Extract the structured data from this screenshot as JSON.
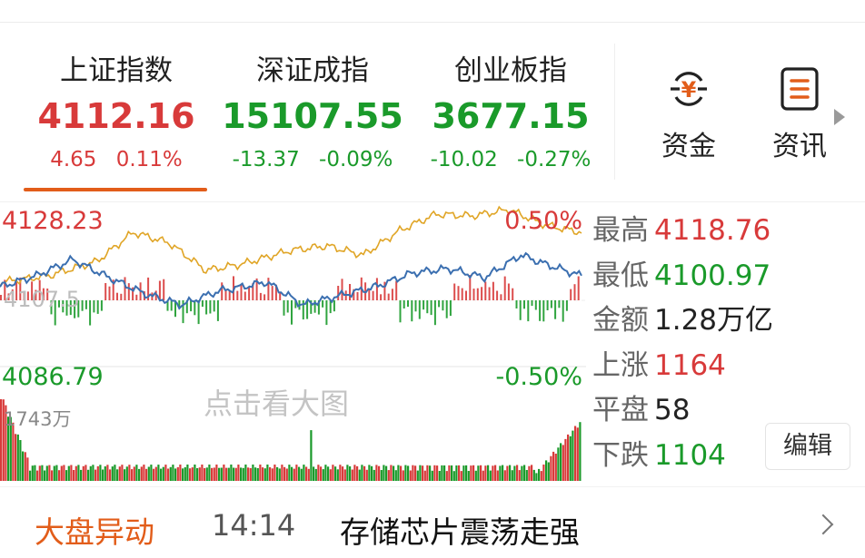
{
  "indices": [
    {
      "name": "上证指数",
      "value": "4112.16",
      "change": "4.65",
      "pct": "0.11%",
      "trend": "up",
      "active": true
    },
    {
      "name": "深证成指",
      "value": "15107.55",
      "change": "-13.37",
      "pct": "-0.09%",
      "trend": "down",
      "active": false
    },
    {
      "name": "创业板指",
      "value": "3677.15",
      "change": "-10.02",
      "pct": "-0.27%",
      "trend": "down",
      "active": false
    }
  ],
  "tools": {
    "funds_label": "资金",
    "funds_icon": "yen-icon",
    "news_label": "资讯",
    "news_icon": "document-icon"
  },
  "chart": {
    "top_price": "4128.23",
    "top_pct": "0.50%",
    "mid_label": "4107.5",
    "bottom_price": "4086.79",
    "bottom_pct": "-0.50%",
    "watermark": "点击看大图",
    "volume_max": "1743万"
  },
  "stats": {
    "high_label": "最高",
    "high_value": "4118.76",
    "low_label": "最低",
    "low_value": "4100.97",
    "amount_label": "金额",
    "amount_value": "1.28万亿",
    "up_label": "上涨",
    "up_value": "1164",
    "flat_label": "平盘",
    "flat_value": "58",
    "down_label": "下跌",
    "down_value": "1104",
    "edit_label": "编辑"
  },
  "alert": {
    "tag": "大盘异动",
    "time": "14:14",
    "message": "存储芯片震荡走强"
  },
  "colors": {
    "up": "#d83a3a",
    "down": "#1a9a2a",
    "accent": "#e25d1a",
    "line_avg": "#e0a526",
    "line_index": "#3b6fb0"
  }
}
